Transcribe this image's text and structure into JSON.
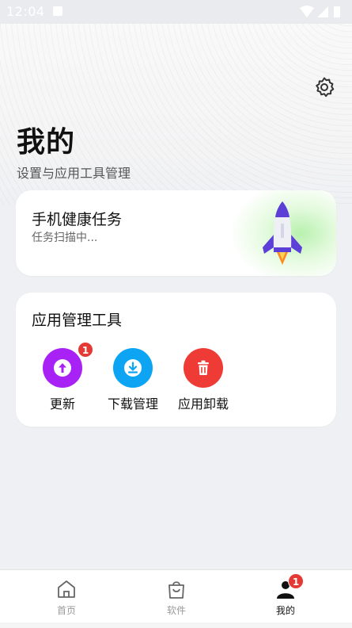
{
  "status_bar": {
    "time": "12:04"
  },
  "header": {
    "title": "我的",
    "subtitle": "设置与应用工具管理",
    "settings_icon": "gear-icon"
  },
  "health_card": {
    "title": "手机健康任务",
    "status": "任务扫描中...",
    "icon": "rocket-icon"
  },
  "tools": {
    "title": "应用管理工具",
    "items": [
      {
        "label": "更新",
        "icon": "upload-arrow-icon",
        "color": "#a821f5",
        "badge": "1"
      },
      {
        "label": "下载管理",
        "icon": "download-icon",
        "color": "#0ea4f4"
      },
      {
        "label": "应用卸载",
        "icon": "trash-icon",
        "color": "#ef3b35"
      }
    ]
  },
  "tab_bar": {
    "tabs": [
      {
        "label": "首页",
        "icon": "home-icon",
        "active": false
      },
      {
        "label": "软件",
        "icon": "shopping-bag-icon",
        "active": false
      },
      {
        "label": "我的",
        "icon": "user-icon",
        "active": true,
        "badge": "1"
      }
    ]
  },
  "colors": {
    "badge": "#e53935",
    "rocket_glow": "#b4f0aa"
  }
}
